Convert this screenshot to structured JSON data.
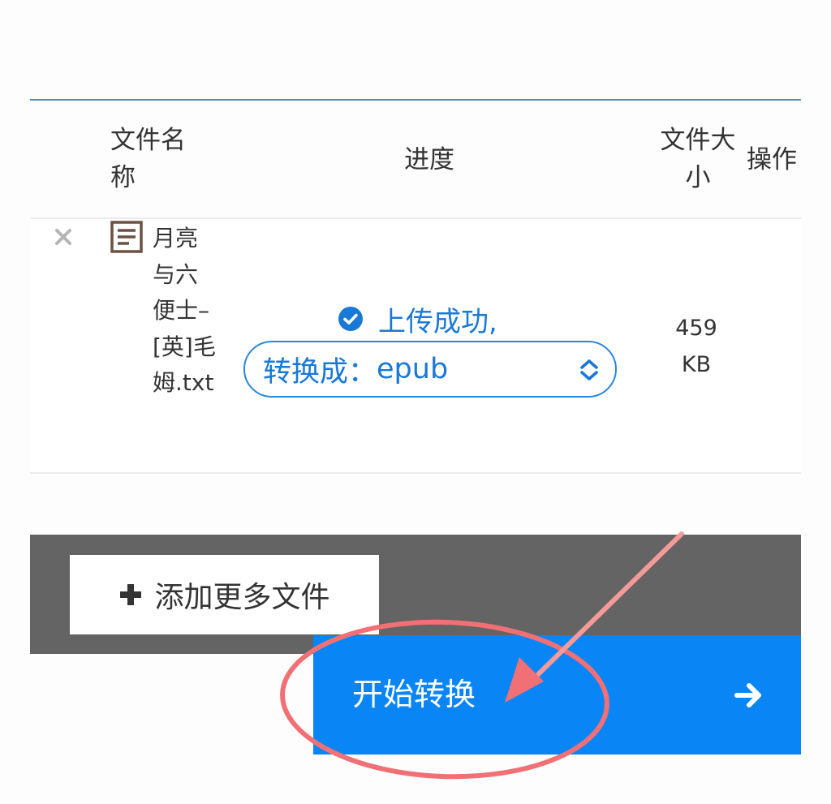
{
  "table": {
    "columns": {
      "name": "文件名称",
      "progress": "进度",
      "size": "文件大小",
      "action": "操作"
    },
    "rows": [
      {
        "file_name": "月亮与六便士–[英]毛姆.txt",
        "status": "上传成功,",
        "convert_label": "转换成：",
        "convert_value": "epub",
        "size": "459 KB"
      }
    ]
  },
  "actions": {
    "add_more": "添加更多文件",
    "start": "开始转换"
  },
  "icons": {
    "remove": "close-icon",
    "file": "text-file-icon",
    "status": "check-circle-icon",
    "select": "chevron-updown-icon",
    "add": "plus-icon",
    "start": "arrow-right-icon"
  },
  "colors": {
    "accent": "#0a85f5",
    "link": "#1a78d6",
    "annotation": "#f07075"
  }
}
